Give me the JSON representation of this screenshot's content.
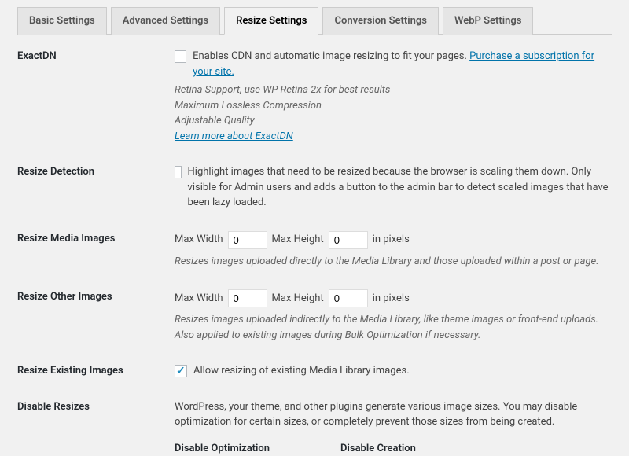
{
  "tabs": [
    {
      "label": "Basic Settings"
    },
    {
      "label": "Advanced Settings"
    },
    {
      "label": "Resize Settings"
    },
    {
      "label": "Conversion Settings"
    },
    {
      "label": "WebP Settings"
    }
  ],
  "rows": {
    "exactdn": {
      "label": "ExactDN",
      "checkbox_text": "Enables CDN and automatic image resizing to fit your pages. ",
      "purchase_link": "Purchase a subscription for your site.",
      "retina": "Retina Support, use WP Retina 2x for best results",
      "lossless": "Maximum Lossless Compression",
      "quality": "Adjustable Quality",
      "learn_more": "Learn more about ExactDN"
    },
    "detect": {
      "label": "Resize Detection",
      "checkbox_text": "Highlight images that need to be resized because the browser is scaling them down. Only visible for Admin users and adds a button to the admin bar to detect scaled images that have been lazy loaded."
    },
    "media": {
      "label": "Resize Media Images",
      "max_width_label": "Max Width",
      "max_width_value": "0",
      "max_height_label": "Max Height",
      "max_height_value": "0",
      "units": "in pixels",
      "desc": "Resizes images uploaded directly to the Media Library and those uploaded within a post or page."
    },
    "other": {
      "label": "Resize Other Images",
      "max_width_label": "Max Width",
      "max_width_value": "0",
      "max_height_label": "Max Height",
      "max_height_value": "0",
      "units": "in pixels",
      "desc": "Resizes images uploaded indirectly to the Media Library, like theme images or front-end uploads. Also applied to existing images during Bulk Optimization if necessary."
    },
    "existing": {
      "label": "Resize Existing Images",
      "checkbox_text": "Allow resizing of existing Media Library images."
    },
    "disable": {
      "label": "Disable Resizes",
      "desc": "WordPress, your theme, and other plugins generate various image sizes. You may disable optimization for certain sizes, or completely prevent those sizes from being created.",
      "col1": "Disable Optimization",
      "col2": "Disable Creation"
    }
  }
}
